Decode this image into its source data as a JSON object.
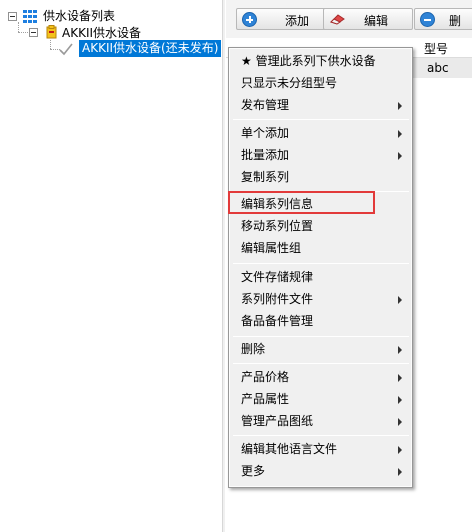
{
  "tree": {
    "root_label": "供水设备列表",
    "series_label": "AKKII供水设备",
    "selected_label": "AKKII供水设备(还未发布)"
  },
  "toolbar": {
    "add_label": "添加",
    "edit_label": "编辑",
    "delete_label": "删"
  },
  "grid": {
    "column_header": "型号",
    "row_value": "abc"
  },
  "context_menu": {
    "items": [
      {
        "label": "★ 管理此系列下供水设备",
        "submenu": false
      },
      {
        "label": "只显示未分组型号",
        "submenu": false
      },
      {
        "label": "发布管理",
        "submenu": true
      },
      {
        "label": "单个添加",
        "submenu": true
      },
      {
        "label": "批量添加",
        "submenu": true
      },
      {
        "label": "复制系列",
        "submenu": false
      },
      {
        "label": "编辑系列信息",
        "submenu": false
      },
      {
        "label": "移动系列位置",
        "submenu": false
      },
      {
        "label": "编辑属性组",
        "submenu": false
      },
      {
        "label": "文件存储规律",
        "submenu": false
      },
      {
        "label": "系列附件文件",
        "submenu": true
      },
      {
        "label": "备品备件管理",
        "submenu": false
      },
      {
        "label": "删除",
        "submenu": true
      },
      {
        "label": "产品价格",
        "submenu": true
      },
      {
        "label": "产品属性",
        "submenu": true
      },
      {
        "label": "管理产品图纸",
        "submenu": true
      },
      {
        "label": "编辑其他语言文件",
        "submenu": true
      },
      {
        "label": "更多",
        "submenu": true
      }
    ],
    "highlighted_item": "编辑系列信息",
    "highlight_color": "#e23a3a"
  },
  "colors": {
    "selection": "#0078d7",
    "icon_blue": "#2f83d6"
  }
}
